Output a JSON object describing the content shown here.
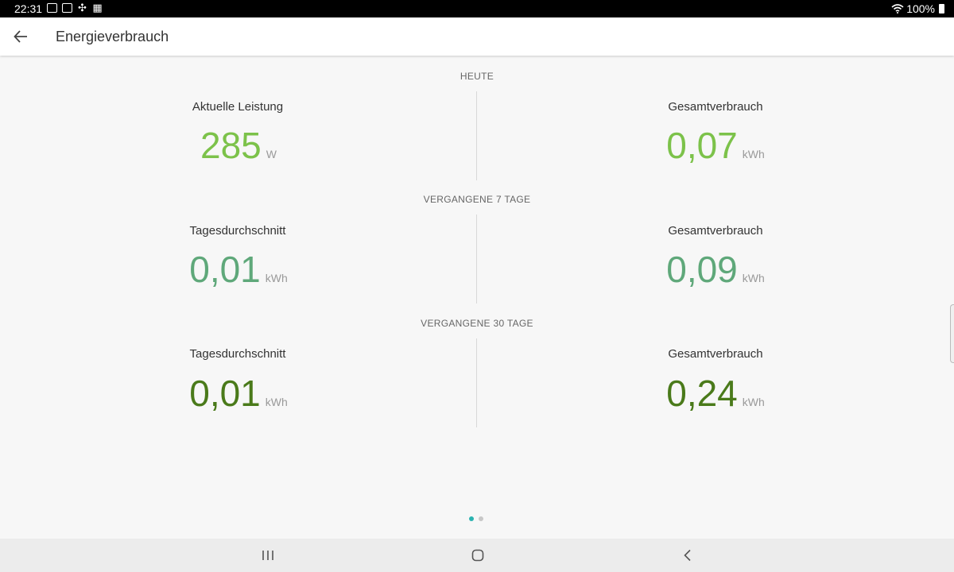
{
  "status_bar": {
    "time": "22:31",
    "battery": "100%",
    "icons": [
      "camera-icon",
      "badge-100-icon",
      "usb-icon",
      "qr-icon",
      "wifi-icon",
      "battery-icon"
    ]
  },
  "app_bar": {
    "title": "Energieverbrauch",
    "back_icon": "arrow-left-icon"
  },
  "sections": [
    {
      "header": "HEUTE",
      "left": {
        "label": "Aktuelle Leistung",
        "value": "285",
        "unit": "W"
      },
      "right": {
        "label": "Gesamtverbrauch",
        "value": "0,07",
        "unit": "kWh"
      },
      "color": "#7cc24a"
    },
    {
      "header": "VERGANGENE 7 TAGE",
      "left": {
        "label": "Tagesdurchschnitt",
        "value": "0,01",
        "unit": "kWh"
      },
      "right": {
        "label": "Gesamtverbrauch",
        "value": "0,09",
        "unit": "kWh"
      },
      "color": "#5fa87a"
    },
    {
      "header": "VERGANGENE 30 TAGE",
      "left": {
        "label": "Tagesdurchschnitt",
        "value": "0,01",
        "unit": "kWh"
      },
      "right": {
        "label": "Gesamtverbrauch",
        "value": "0,24",
        "unit": "kWh"
      },
      "color": "#4a7a1a"
    }
  ],
  "page_indicator": {
    "total": 2,
    "active": 1,
    "active_color": "#2bb3b0",
    "inactive_color": "#c8c8c8"
  },
  "nav_bar": {
    "buttons": [
      "recent-apps-icon",
      "home-icon",
      "back-icon"
    ]
  }
}
